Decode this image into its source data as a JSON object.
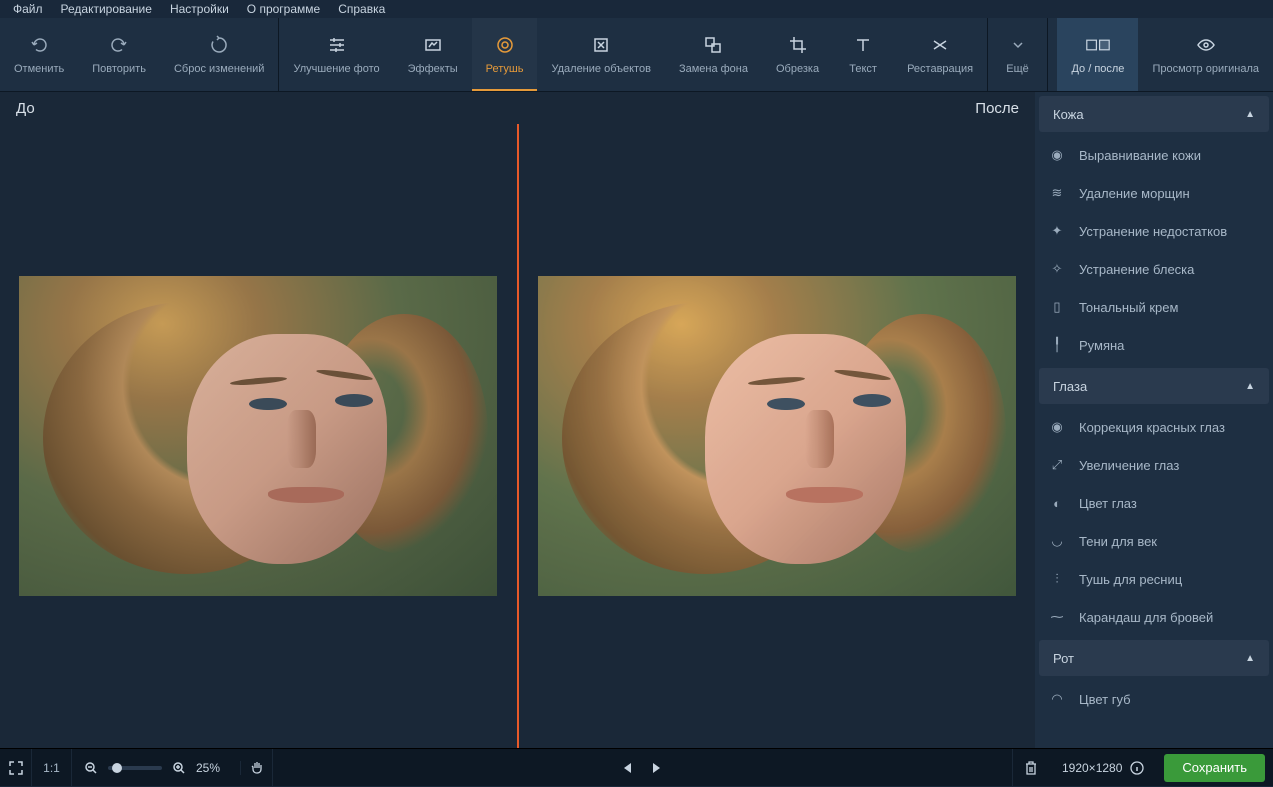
{
  "menubar": [
    "Файл",
    "Редактирование",
    "Настройки",
    "О программе",
    "Справка"
  ],
  "toolbar": {
    "undo": "Отменить",
    "redo": "Повторить",
    "reset": "Сброс изменений",
    "enhance": "Улучшение фото",
    "effects": "Эффекты",
    "retouch": "Ретушь",
    "erase": "Удаление объектов",
    "bg": "Замена фона",
    "crop": "Обрезка",
    "text": "Текст",
    "restore": "Реставрация",
    "more": "Ещё",
    "ba": "До / после",
    "orig": "Просмотр оригинала"
  },
  "before": "До",
  "after": "После",
  "sections": {
    "skin": "Кожа",
    "eyes": "Глаза",
    "mouth": "Рот"
  },
  "skin_tools": [
    "Выравнивание кожи",
    "Удаление морщин",
    "Устранение недостатков",
    "Устранение блеска",
    "Тональный крем",
    "Румяна"
  ],
  "eye_tools": [
    "Коррекция красных глаз",
    "Увеличение глаз",
    "Цвет глаз",
    "Тени для век",
    "Тушь для ресниц",
    "Карандаш для бровей"
  ],
  "mouth_tools": [
    "Цвет губ"
  ],
  "statusbar": {
    "fit": "1:1",
    "zoom": "25%",
    "dims": "1920×1280",
    "save": "Сохранить"
  }
}
